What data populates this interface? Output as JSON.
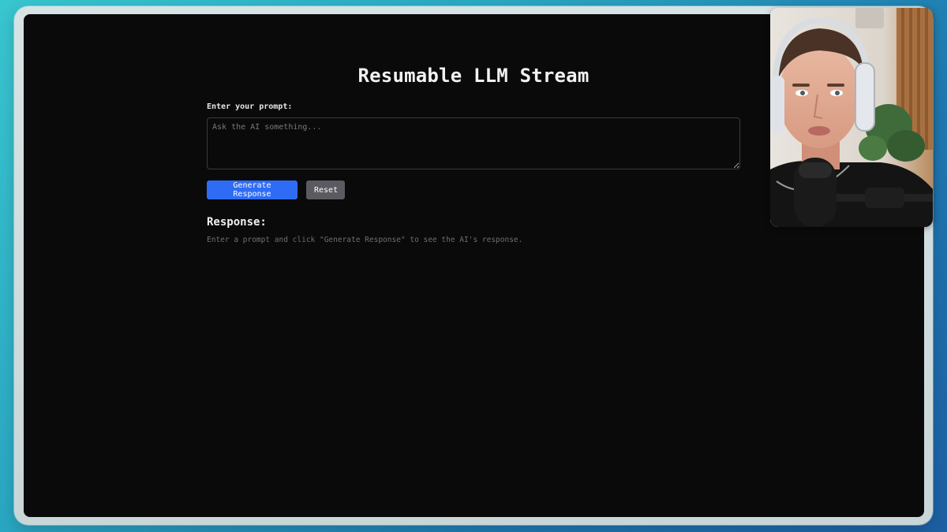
{
  "app": {
    "title": "Resumable LLM Stream",
    "prompt_label": "Enter your prompt:",
    "prompt_value": "",
    "prompt_placeholder": "Ask the AI something...",
    "generate_label": "Generate Response",
    "reset_label": "Reset",
    "response_heading": "Response:",
    "response_text": "Enter a prompt and click \"Generate Response\" to see the AI's response."
  },
  "colors": {
    "accent": "#2f6cf6",
    "reset": "#5a5a60",
    "background": "#0a0a0a"
  },
  "overlay": {
    "webcam_icon": "webcam-person"
  }
}
